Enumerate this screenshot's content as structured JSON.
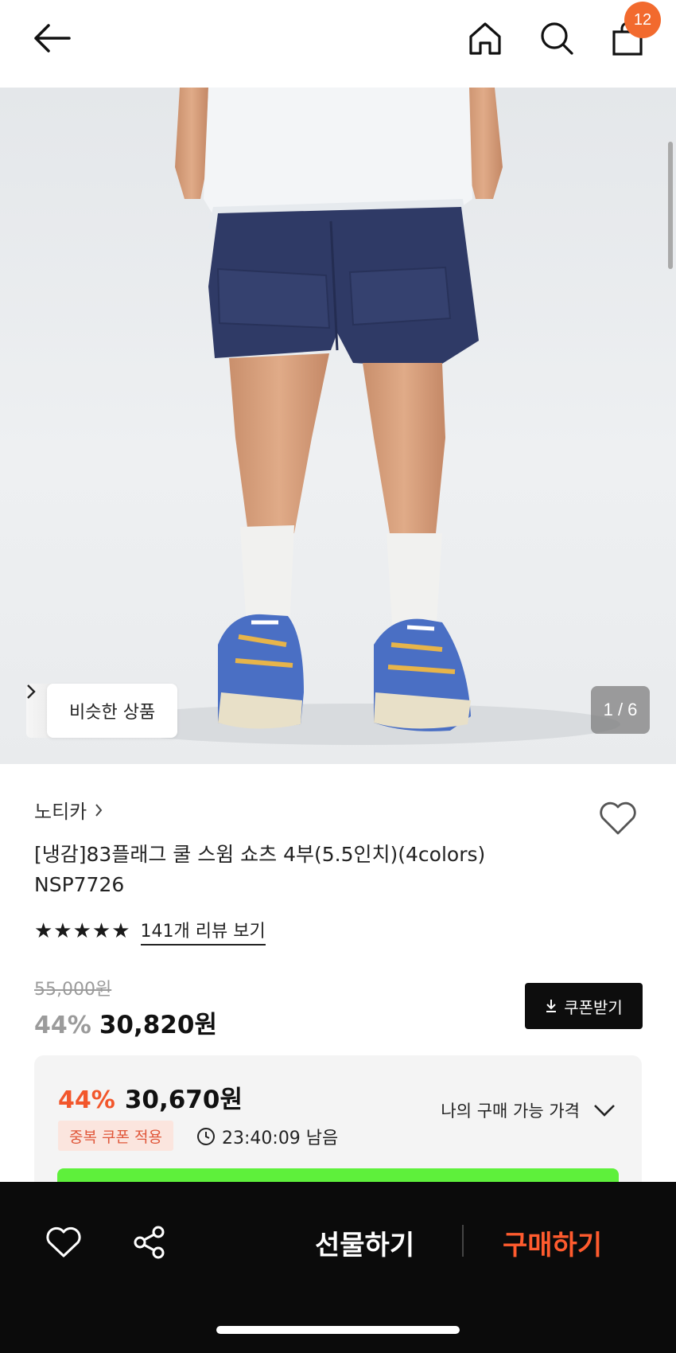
{
  "header": {
    "back_icon": "arrow-left-icon",
    "home_icon": "home-icon",
    "search_icon": "search-icon",
    "bag_icon": "shopping-bag-icon",
    "cart_count": "12"
  },
  "hero": {
    "similar_label": "비슷한 상품",
    "page_indicator": "1 / 6"
  },
  "product": {
    "brand": "노티카",
    "title_line1": "[냉감]83플래그 쿨 스윔 쇼츠 4부(5.5인치)(4colors)",
    "title_line2": "NSP7726",
    "stars": "★★★★★",
    "review_link": "141개 리뷰 보기",
    "original_price": "55,000원",
    "discount_rate": "44%",
    "sale_price": "30,820원",
    "coupon_button": "쿠폰받기"
  },
  "my_price": {
    "discount_rate": "44%",
    "price": "30,670원",
    "badge": "중복 쿠폰 적용",
    "countdown": "23:40:09 남음",
    "label": "나의 구매 가능 가격"
  },
  "bottom_bar": {
    "gift_label": "선물하기",
    "buy_label": "구매하기"
  },
  "colors": {
    "accent_orange": "#f26a2e",
    "discount_red": "#f2562b",
    "buy_orange": "#ff5b2e",
    "promo_green": "#5ef03b",
    "shorts_navy": "#2f3a66"
  }
}
